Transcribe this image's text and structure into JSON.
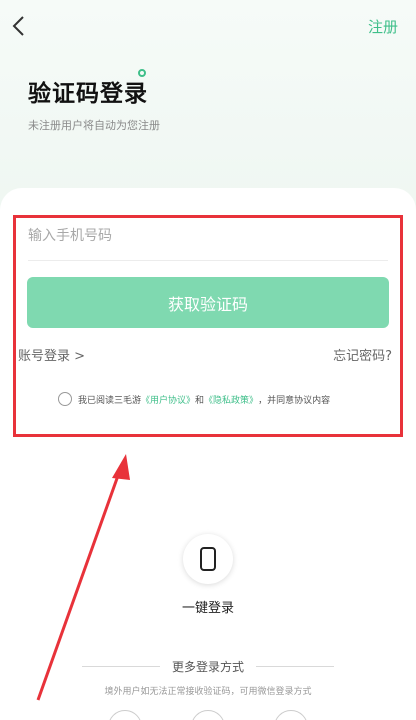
{
  "header": {
    "register_label": "注册"
  },
  "page": {
    "title": "验证码登录",
    "subtitle": "未注册用户将自动为您注册"
  },
  "form": {
    "phone_placeholder": "输入手机号码",
    "phone_value": "",
    "get_code_label": "获取验证码",
    "account_login_label": "账号登录 >",
    "forgot_password_label": "忘记密码?"
  },
  "agreement": {
    "prefix": "我已阅读三毛游",
    "user_agreement": "《用户协议》",
    "and": "和",
    "privacy_policy": "《隐私政策》",
    "suffix": "，并同意协议内容"
  },
  "quick_login": {
    "label": "一键登录"
  },
  "more": {
    "title": "更多登录方式",
    "hint": "境外用户如无法正常接收验证码，可用微信登录方式"
  },
  "colors": {
    "accent": "#3fbf8a",
    "button": "#7fd9b0",
    "annotation": "#e8323a"
  }
}
